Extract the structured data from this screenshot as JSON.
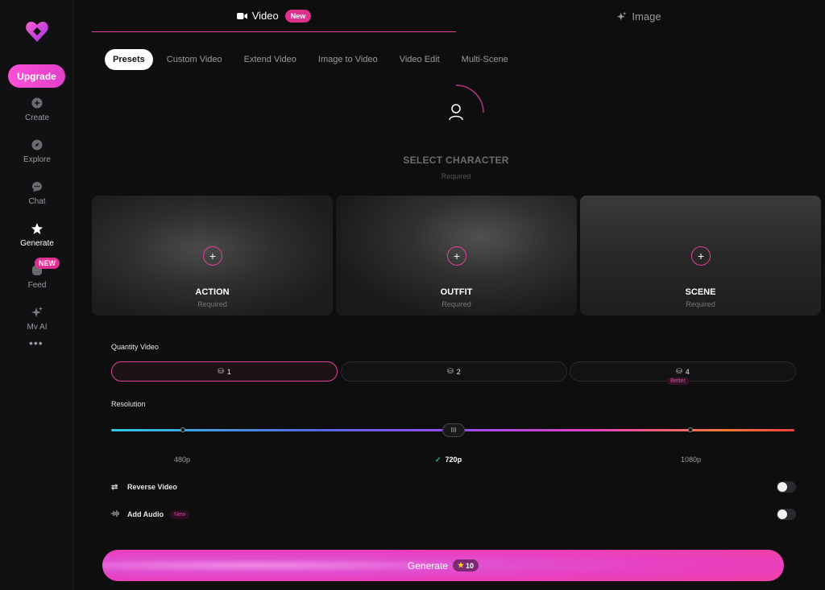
{
  "sidebar": {
    "upgrade_label": "Upgrade",
    "items": [
      {
        "label": "Create",
        "icon": "plus-circle-icon"
      },
      {
        "label": "Explore",
        "icon": "compass-icon"
      },
      {
        "label": "Chat",
        "icon": "chat-bubble-icon"
      },
      {
        "label": "Generate",
        "icon": "sparkle-star-icon"
      },
      {
        "label": "Feed",
        "icon": "feed-icon",
        "badge": "NEW"
      },
      {
        "label": "My AI",
        "icon": "sparkles-icon"
      }
    ],
    "more": "•••"
  },
  "top_tabs": {
    "video": "Video",
    "video_badge": "New",
    "image": "Image"
  },
  "sub_tabs": [
    "Presets",
    "Custom Video",
    "Extend Video",
    "Image to Video",
    "Video Edit",
    "Multi-Scene"
  ],
  "character": {
    "title": "SELECT CHARACTER",
    "required": "Required"
  },
  "cards": [
    {
      "label": "ACTION",
      "required": "Required"
    },
    {
      "label": "OUTFIT",
      "required": "Required"
    },
    {
      "label": "SCENE",
      "required": "Required"
    }
  ],
  "quantity": {
    "label": "Quantity Video",
    "options": [
      "1",
      "2",
      "4"
    ],
    "selected": "1",
    "badge": "Better"
  },
  "resolution": {
    "label": "Resolution",
    "options": [
      "480p",
      "720p",
      "1080p"
    ],
    "selected": "720p",
    "check": "✓",
    "thumb": "III"
  },
  "options": {
    "reverse_video": "Reverse Video",
    "add_audio": "Add Audio",
    "add_audio_badge": "New"
  },
  "generate": {
    "label": "Generate",
    "cost": "10"
  },
  "colors": {
    "accent": "#e0409a",
    "upgrade": "#ff4fd8",
    "check": "#33c07a"
  }
}
